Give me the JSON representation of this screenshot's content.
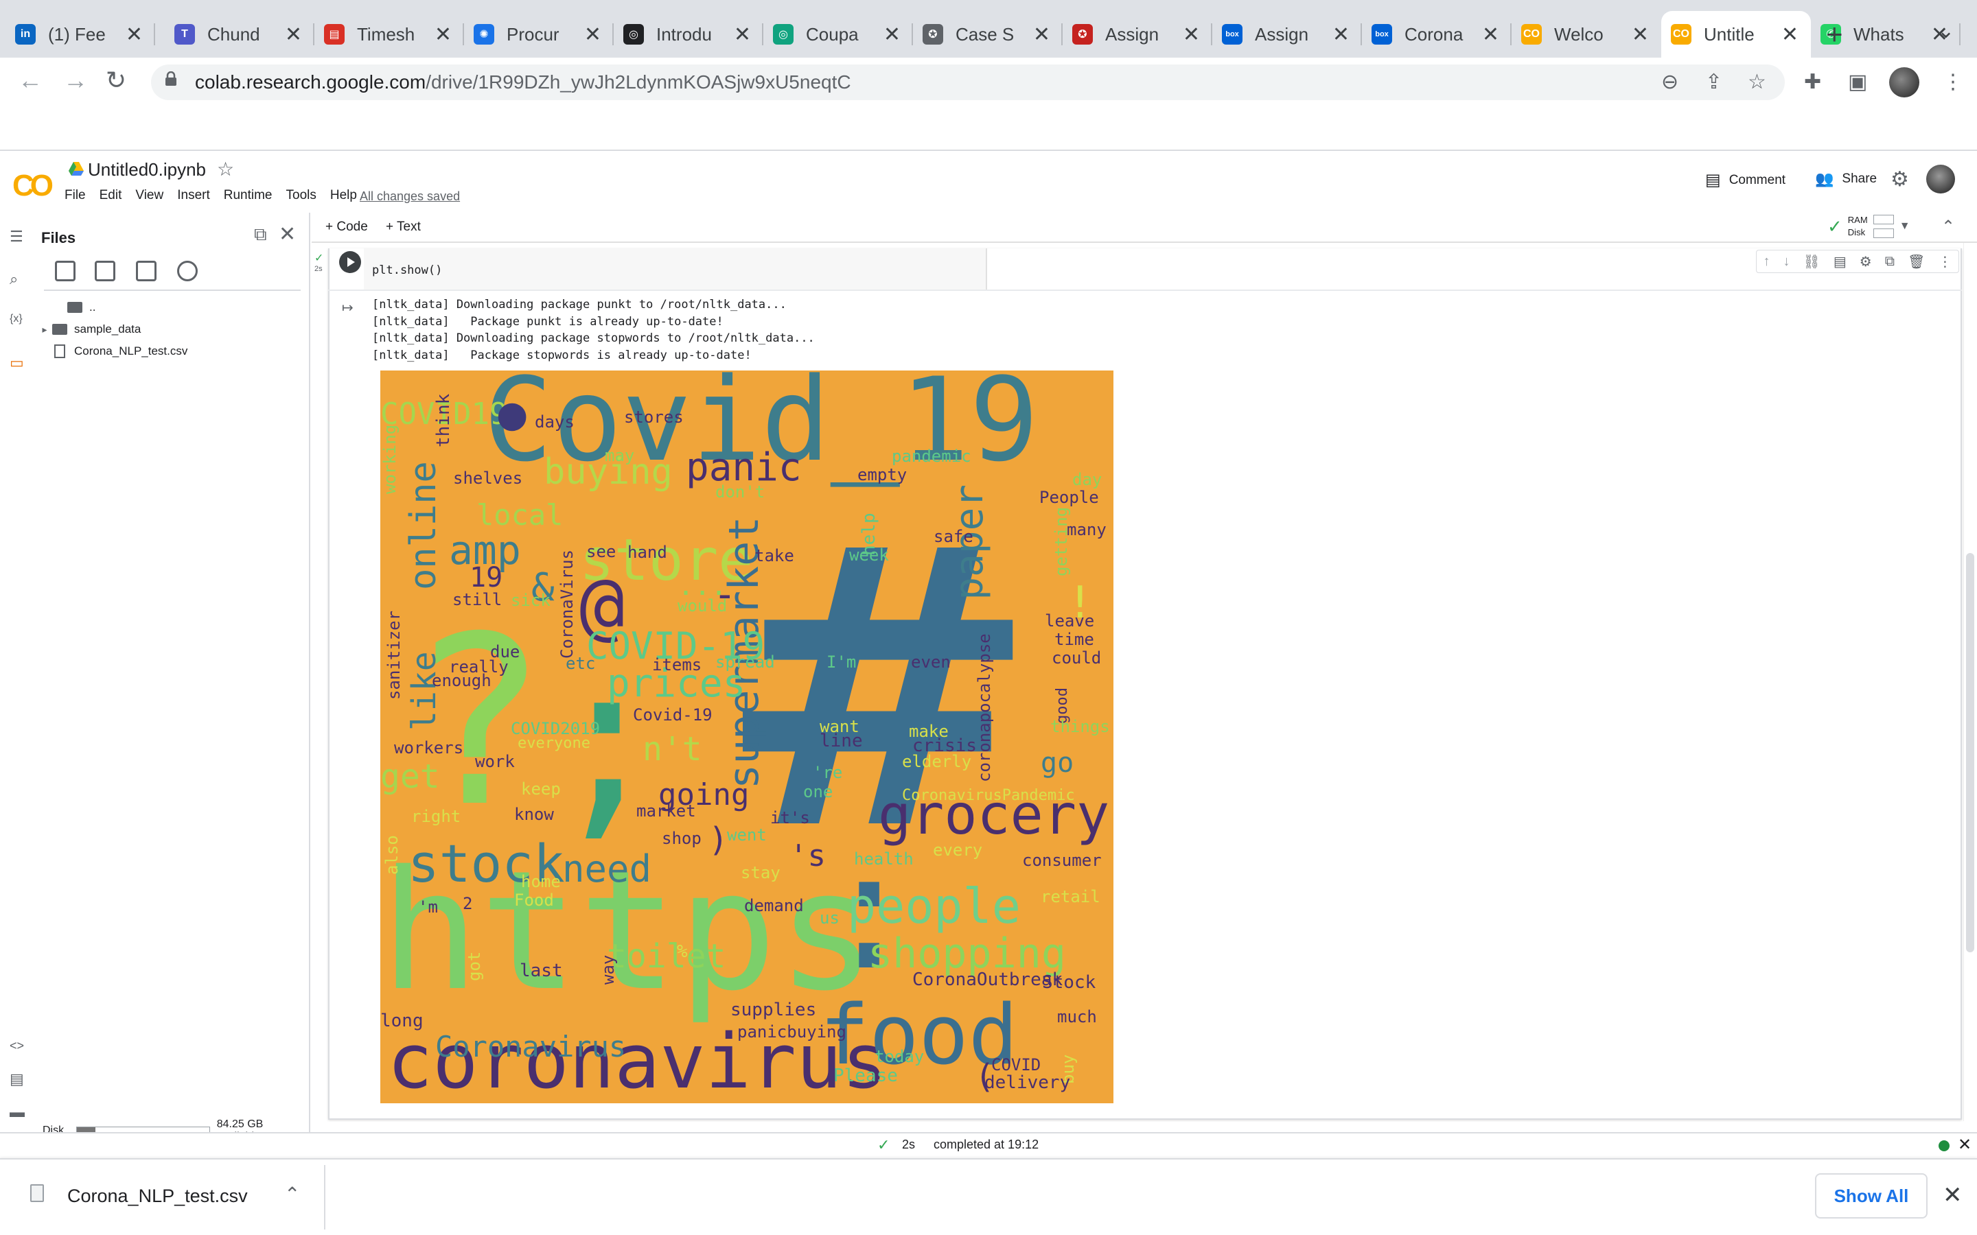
{
  "browser": {
    "tabs": [
      {
        "title": "(1) Fee",
        "icon": "linkedin-icon",
        "color": "#0a66c2",
        "glyph": "in"
      },
      {
        "title": "Chund",
        "icon": "teams-icon",
        "color": "#5059c9",
        "glyph": "T"
      },
      {
        "title": "Timesh",
        "icon": "timesheet-icon",
        "color": "#d93025",
        "glyph": "▤"
      },
      {
        "title": "Procur",
        "icon": "gear-badge-icon",
        "color": "#1a73e8",
        "glyph": "✺"
      },
      {
        "title": "Introdu",
        "icon": "openai-icon",
        "color": "#202124",
        "glyph": "◎"
      },
      {
        "title": "Coupa",
        "icon": "openai-icon",
        "color": "#10a37f",
        "glyph": "◎"
      },
      {
        "title": "Case S",
        "icon": "seal-icon",
        "color": "#5f6368",
        "glyph": "✪"
      },
      {
        "title": "Assign",
        "icon": "seal-icon",
        "color": "#c5221f",
        "glyph": "✪"
      },
      {
        "title": "Assign",
        "icon": "box-icon",
        "color": "#0061d5",
        "glyph": "box"
      },
      {
        "title": "Corona",
        "icon": "box-icon",
        "color": "#0061d5",
        "glyph": "box"
      },
      {
        "title": "Welco",
        "icon": "colab-icon",
        "color": "#f9ab00",
        "glyph": "CO"
      },
      {
        "title": "Untitle",
        "icon": "colab-icon",
        "color": "#f9ab00",
        "glyph": "CO"
      },
      {
        "title": "Whats",
        "icon": "whatsapp-icon",
        "color": "#25d366",
        "glyph": "✆"
      }
    ],
    "active_tab_index": 11,
    "url_host": "colab.research.google.com",
    "url_path": "/drive/1R99DZh_ywJh2LdynmKOASjw9xU5neqtC"
  },
  "colab": {
    "notebook_name": "Untitled0.ipynb",
    "menu": [
      "File",
      "Edit",
      "View",
      "Insert",
      "Runtime",
      "Tools",
      "Help"
    ],
    "save_status": "All changes saved",
    "comment_label": "Comment",
    "share_label": "Share",
    "add_code_label": "+ Code",
    "add_text_label": "+ Text",
    "ram_label": "RAM",
    "disk_label": "Disk"
  },
  "files_panel": {
    "title": "Files",
    "items": [
      {
        "name": "..",
        "type": "folder-up"
      },
      {
        "name": "sample_data",
        "type": "folder"
      },
      {
        "name": "Corona_NLP_test.csv",
        "type": "file"
      }
    ],
    "disk_label": "Disk",
    "disk_available": "84.25 GB available",
    "disk_used_fraction": 0.14
  },
  "cell": {
    "exec_time": "2s",
    "code": "plt.show()",
    "output_lines": [
      "[nltk_data] Downloading package punkt to /root/nltk_data...",
      "[nltk_data]   Package punkt is already up-to-date!",
      "[nltk_data] Downloading package stopwords to /root/nltk_data...",
      "[nltk_data]   Package stopwords is already up-to-date!"
    ]
  },
  "wordcloud": {
    "background": "#f0a53a",
    "words": [
      {
        "t": "#",
        "c": "#3b6f8f"
      },
      {
        "t": "https",
        "c": "#7ccf6a"
      },
      {
        "t": ":",
        "c": "#3b6f8f"
      },
      {
        "t": "Covid_19",
        "c": "#3e7d8c"
      },
      {
        "t": "?",
        "c": "#8ed45b"
      },
      {
        "t": ";",
        "c": "#3aa37a"
      },
      {
        "t": "coronavirus",
        "c": "#4a2f6e"
      },
      {
        "t": "food",
        "c": "#3b6f8f"
      },
      {
        "t": "grocery",
        "c": "#4a2f6e"
      },
      {
        "t": "store",
        "c": "#b5d84a"
      },
      {
        "t": "stock",
        "c": "#3e7d8c"
      },
      {
        "t": "people",
        "c": "#6fcf8a"
      },
      {
        "t": "supermarket",
        "c": "#3b6f8f"
      },
      {
        "t": "@",
        "c": "#4a2f6e"
      },
      {
        "t": "prices",
        "c": "#5dc989"
      },
      {
        "t": "need",
        "c": "#3e7d8c"
      },
      {
        "t": "shopping",
        "c": "#8ed45b"
      },
      {
        "t": "panic",
        "c": "#4a2f6e"
      },
      {
        "t": "paper",
        "c": "#3e7d8c"
      },
      {
        "t": "buying",
        "c": "#b5d84a"
      },
      {
        "t": "online",
        "c": "#3e7d8c"
      },
      {
        "t": "amp",
        "c": "#3e7d8c"
      },
      {
        "t": "COVID-19",
        "c": "#5dc989"
      },
      {
        "t": "toilet",
        "c": "#8ed45b"
      },
      {
        "t": "Coronavirus",
        "c": "#3e7d8c"
      },
      {
        "t": "going",
        "c": "#4a2f6e"
      },
      {
        "t": "like",
        "c": "#3e7d8c"
      },
      {
        "t": "n't",
        "c": "#b5d84a"
      },
      {
        "t": "COVID19",
        "c": "#a5d64e"
      },
      {
        "t": "local",
        "c": "#a5d64e"
      },
      {
        "t": "&",
        "c": "#3e7d8c"
      },
      {
        "t": "get",
        "c": "#a5d64e"
      },
      {
        "t": "go",
        "c": "#3e7d8c"
      },
      {
        "t": "!",
        "c": "#d8e04a"
      },
      {
        "t": "19",
        "c": "#4a2f6e"
      },
      {
        "t": "...",
        "c": "#8ed45b"
      },
      {
        "t": "-",
        "c": "#4a2f6e"
      },
      {
        "t": "'s",
        "c": "#4a2f6e"
      },
      {
        "t": ")",
        "c": "#4a2f6e"
      },
      {
        "t": "(",
        "c": "#4a2f6e"
      },
      {
        "t": "days",
        "c": "#4a2f6e"
      },
      {
        "t": "stores",
        "c": "#4a2f6e"
      },
      {
        "t": "may",
        "c": "#8ed45b"
      },
      {
        "t": "pandemic",
        "c": "#5dc989"
      },
      {
        "t": "think",
        "c": "#4a2f6e"
      },
      {
        "t": "working",
        "c": "#8ed45b"
      },
      {
        "t": "shelves",
        "c": "#4a2f6e"
      },
      {
        "t": "empty",
        "c": "#4a2f6e"
      },
      {
        "t": "day",
        "c": "#8ed45b"
      },
      {
        "t": "People",
        "c": "#4a2f6e"
      },
      {
        "t": "don't",
        "c": "#8ed45b"
      },
      {
        "t": "help",
        "c": "#5dc989"
      },
      {
        "t": "getting",
        "c": "#8ed45b"
      },
      {
        "t": "many",
        "c": "#4a2f6e"
      },
      {
        "t": "safe",
        "c": "#4a2f6e"
      },
      {
        "t": "hand",
        "c": "#4a2f6e"
      },
      {
        "t": "see",
        "c": "#4a2f6e"
      },
      {
        "t": "take",
        "c": "#4a2f6e"
      },
      {
        "t": "week",
        "c": "#5dc989"
      },
      {
        "t": "still",
        "c": "#4a2f6e"
      },
      {
        "t": "sick",
        "c": "#8ed45b"
      },
      {
        "t": "CoronaVirus",
        "c": "#4a2f6e"
      },
      {
        "t": "would",
        "c": "#8ed45b"
      },
      {
        "t": "leave",
        "c": "#4a2f6e"
      },
      {
        "t": "time",
        "c": "#4a2f6e"
      },
      {
        "t": "could",
        "c": "#4a2f6e"
      },
      {
        "t": "sanitizer",
        "c": "#4a2f6e"
      },
      {
        "t": "due",
        "c": "#4a2f6e"
      },
      {
        "t": "really",
        "c": "#4a2f6e"
      },
      {
        "t": "enough",
        "c": "#4a2f6e"
      },
      {
        "t": "etc",
        "c": "#3e7d8c"
      },
      {
        "t": "items",
        "c": "#4a2f6e"
      },
      {
        "t": "spread",
        "c": "#5dc989"
      },
      {
        "t": "I'm",
        "c": "#5dc989"
      },
      {
        "t": "even",
        "c": "#4a2f6e"
      },
      {
        "t": "coronapocalypse",
        "c": "#4a2f6e"
      },
      {
        "t": "good",
        "c": "#4a2f6e"
      },
      {
        "t": "things",
        "c": "#8ed45b"
      },
      {
        "t": "Covid-19",
        "c": "#4a2f6e"
      },
      {
        "t": "COVID2019",
        "c": "#5dc989"
      },
      {
        "t": "workers",
        "c": "#4a2f6e"
      },
      {
        "t": "everyone",
        "c": "#d8e04a"
      },
      {
        "t": "want",
        "c": "#d8e04a"
      },
      {
        "t": "line",
        "c": "#4a2f6e"
      },
      {
        "t": "make",
        "c": "#d8e04a"
      },
      {
        "t": "crisis",
        "c": "#4a2f6e"
      },
      {
        "t": "elderly",
        "c": "#d8e04a"
      },
      {
        "t": "work",
        "c": "#4a2f6e"
      },
      {
        "t": "'re",
        "c": "#5dc989"
      },
      {
        "t": "one",
        "c": "#5dc989"
      },
      {
        "t": "keep",
        "c": "#d8e04a"
      },
      {
        "t": "CoronavirusPandemic",
        "c": "#d8e04a"
      },
      {
        "t": "right",
        "c": "#d8e04a"
      },
      {
        "t": "know",
        "c": "#4a2f6e"
      },
      {
        "t": "market",
        "c": "#4a2f6e"
      },
      {
        "t": "it's",
        "c": "#4a2f6e"
      },
      {
        "t": "shop",
        "c": "#4a2f6e"
      },
      {
        "t": "went",
        "c": "#5dc989"
      },
      {
        "t": "also",
        "c": "#d8e04a"
      },
      {
        "t": "home",
        "c": "#d8e04a"
      },
      {
        "t": "every",
        "c": "#d8e04a"
      },
      {
        "t": "health",
        "c": "#5dc989"
      },
      {
        "t": "consumer",
        "c": "#4a2f6e"
      },
      {
        "t": "stay",
        "c": "#d8e04a"
      },
      {
        "t": "'m",
        "c": "#4a2f6e"
      },
      {
        "t": "2",
        "c": "#4a2f6e"
      },
      {
        "t": "Food",
        "c": "#d8e04a"
      },
      {
        "t": "demand",
        "c": "#4a2f6e"
      },
      {
        "t": "retail",
        "c": "#d8e04a"
      },
      {
        "t": "us",
        "c": "#5dc989"
      },
      {
        "t": "got",
        "c": "#d8e04a"
      },
      {
        "t": "last",
        "c": "#4a2f6e"
      },
      {
        "t": "way",
        "c": "#4a2f6e"
      },
      {
        "t": "%",
        "c": "#d8e04a"
      },
      {
        "t": "CoronaOutbreak",
        "c": "#4a2f6e"
      },
      {
        "t": "Stock",
        "c": "#4a2f6e"
      },
      {
        "t": "long",
        "c": "#4a2f6e"
      },
      {
        "t": "supplies",
        "c": "#4a2f6e"
      },
      {
        "t": "much",
        "c": "#4a2f6e"
      },
      {
        "t": "panicbuying",
        "c": "#4a2f6e"
      },
      {
        "t": "buy",
        "c": "#d8e04a"
      },
      {
        "t": "today",
        "c": "#5dc989"
      },
      {
        "t": "COVID",
        "c": "#4a2f6e"
      },
      {
        "t": "Please",
        "c": "#5dc989"
      },
      {
        "t": "delivery",
        "c": "#4a2f6e"
      },
      {
        "t": "•",
        "c": "#3e3a7a"
      }
    ]
  },
  "status": {
    "time": "2s",
    "text": "completed at 19:12"
  },
  "downloads": {
    "file": "Corona_NLP_test.csv",
    "show_all": "Show All"
  }
}
